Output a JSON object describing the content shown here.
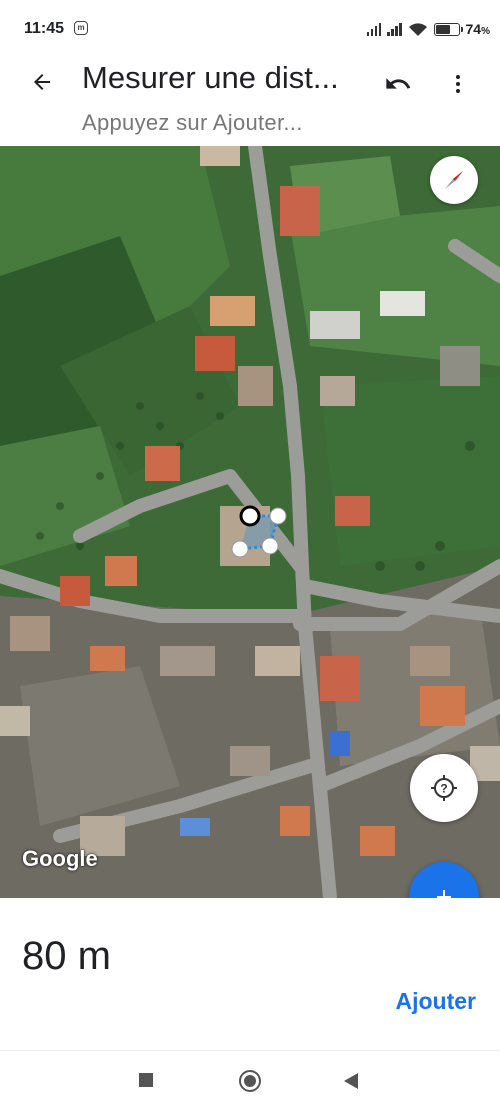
{
  "status_bar": {
    "time": "11:45",
    "battery_percent": "74",
    "battery_level": 0.74,
    "icons": [
      "notification-icon",
      "signal-icon",
      "signal-icon",
      "wifi-icon",
      "battery-icon"
    ]
  },
  "header": {
    "title": "Mesurer une dist...",
    "subtitle": "Appuyez sur Ajouter...",
    "icons": {
      "back": "back-arrow-icon",
      "undo": "undo-icon",
      "more": "more-vert-icon"
    }
  },
  "map": {
    "attribution": "Google",
    "icons": {
      "compass": "compass-icon",
      "location": "my-location-icon",
      "add": "add-icon"
    },
    "colors": {
      "measure_line": "#2f8bd8",
      "fab": "#1a73e8"
    }
  },
  "bottom_panel": {
    "distance": "80 m",
    "add_label": "Ajouter"
  },
  "nav_bar": {
    "icons": [
      "recent-apps-icon",
      "home-icon",
      "back-icon"
    ]
  },
  "colors": {
    "accent": "#1a73e8",
    "text_primary": "#202124",
    "text_secondary": "#777777"
  }
}
